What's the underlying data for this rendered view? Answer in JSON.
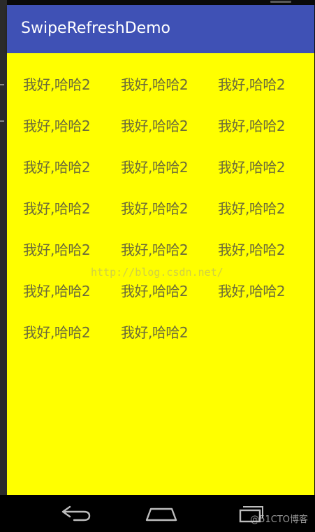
{
  "app_bar": {
    "title": "SwipeRefreshDemo",
    "color": "#3f51b5"
  },
  "content": {
    "background": "#ffff00",
    "items": [
      "我好,哈哈2",
      "我好,哈哈2",
      "我好,哈哈2",
      "我好,哈哈2",
      "我好,哈哈2",
      "我好,哈哈2",
      "我好,哈哈2",
      "我好,哈哈2",
      "我好,哈哈2",
      "我好,哈哈2",
      "我好,哈哈2",
      "我好,哈哈2",
      "我好,哈哈2",
      "我好,哈哈2",
      "我好,哈哈2",
      "我好,哈哈2",
      "我好,哈哈2",
      "我好,哈哈2",
      "我好,哈哈2",
      "我好,哈哈2"
    ]
  },
  "watermark": "http://blog.csdn.net/",
  "nav_bar": {
    "back_icon": "back-icon",
    "home_icon": "home-icon",
    "recents_icon": "recents-icon"
  },
  "credit": "@51CTO博客"
}
